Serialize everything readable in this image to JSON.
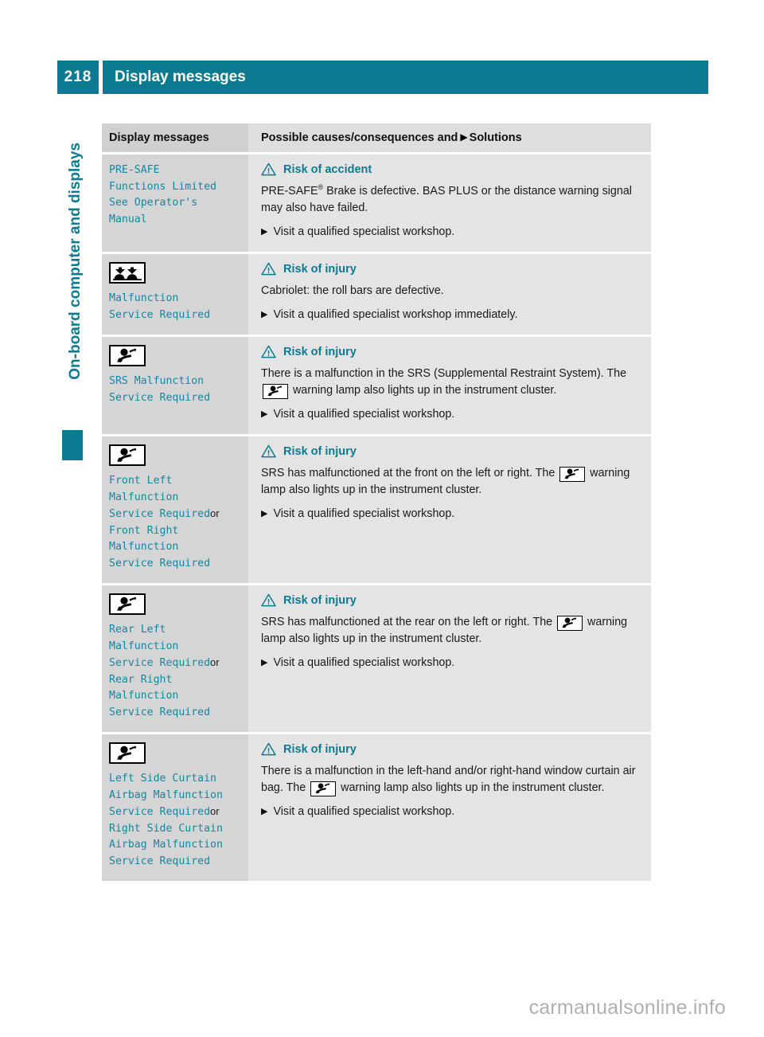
{
  "header": {
    "page_number": "218",
    "title": "Display messages"
  },
  "chapter_tab": {
    "label": "On-board computer and displays"
  },
  "table": {
    "columns": {
      "left": "Display messages",
      "right_prefix": "Possible causes/consequences and",
      "right_flag": "▶",
      "right_suffix": "Solutions"
    },
    "rows": [
      {
        "icon": "none",
        "message": "PRE-SAFE\nFunctions Limited\nSee Operator's\nManual",
        "or_label": "",
        "message_alt": "",
        "warning_title": "Risk of accident",
        "body_pre": "PRE-SAFE",
        "body_sup": "®",
        "body_post": " Brake is defective. BAS PLUS or the distance warning signal may also have failed.",
        "body_tail": "",
        "has_inline_icon": false,
        "solution_flag": "▶",
        "solution": "Visit a qualified specialist workshop."
      },
      {
        "icon": "rollbar-icon",
        "message": "Malfunction\nService Required",
        "or_label": "",
        "message_alt": "",
        "warning_title": "Risk of injury",
        "body_pre": "Cabriolet: the roll bars are defective.",
        "body_sup": "",
        "body_post": "",
        "body_tail": "",
        "has_inline_icon": false,
        "solution_flag": "▶",
        "solution": "Visit a qualified specialist workshop immediately."
      },
      {
        "icon": "srs-airbag-icon",
        "message": "SRS Malfunction\nService Required",
        "or_label": "",
        "message_alt": "",
        "warning_title": "Risk of injury",
        "body_pre": "There is a malfunction in the SRS (Supplemental Restraint System). The ",
        "body_sup": "",
        "body_post": "",
        "body_tail": " warning lamp also lights up in the instrument cluster.",
        "has_inline_icon": true,
        "solution_flag": "▶",
        "solution": "Visit a qualified specialist workshop."
      },
      {
        "icon": "srs-airbag-icon",
        "message": "Front Left\nMalfunction\nService Required",
        "or_label": "or",
        "message_alt": "Front Right\nMalfunction\nService Required",
        "warning_title": "Risk of injury",
        "body_pre": "SRS has malfunctioned at the front on the left or right. The ",
        "body_sup": "",
        "body_post": "",
        "body_tail": " warning lamp also lights up in the instrument cluster.",
        "has_inline_icon": true,
        "solution_flag": "▶",
        "solution": "Visit a qualified specialist workshop."
      },
      {
        "icon": "srs-airbag-icon",
        "message": "Rear Left\nMalfunction\nService Required",
        "or_label": "or",
        "message_alt": "Rear Right\nMalfunction\nService Required",
        "warning_title": "Risk of injury",
        "body_pre": "SRS has malfunctioned at the rear on the left or right. The ",
        "body_sup": "",
        "body_post": "",
        "body_tail": " warning lamp also lights up in the instrument cluster.",
        "has_inline_icon": true,
        "solution_flag": "▶",
        "solution": "Visit a qualified specialist workshop."
      },
      {
        "icon": "srs-airbag-icon",
        "message": "Left Side Curtain\nAirbag Malfunction\nService Required",
        "or_label": "or",
        "message_alt": "Right Side Curtain\nAirbag Malfunction\nService Required",
        "warning_title": "Risk of injury",
        "body_pre": "There is a malfunction in the left-hand and/or right-hand window curtain air bag. The ",
        "body_sup": "",
        "body_post": "",
        "body_tail": " warning lamp also lights up in the instrument cluster.",
        "has_inline_icon": true,
        "solution_flag": "▶",
        "solution": "Visit a qualified specialist workshop."
      }
    ]
  },
  "watermark": "carmanualsonline.info",
  "colors": {
    "teal": "#0c7a91",
    "message_teal": "#1786a0",
    "col_left_bg": "#d5d5d5",
    "col_right_bg": "#e4e4e4"
  }
}
